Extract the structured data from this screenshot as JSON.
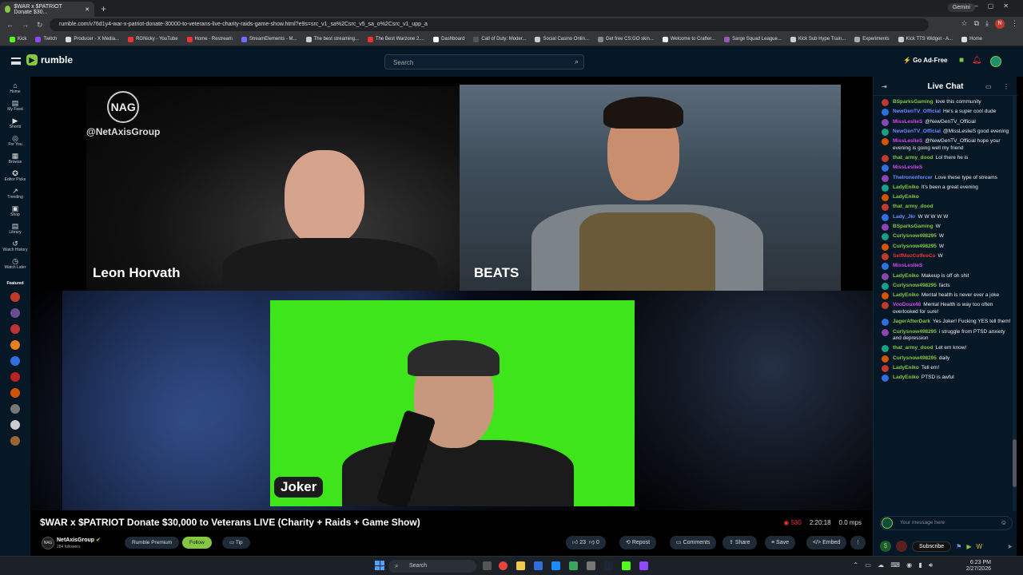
{
  "browser": {
    "tab_title": "$WAR x $PATRIOT Donate $30...",
    "gemini_label": "Gemini",
    "url": "rumble.com/v76d1y4-war-x-patriot-donate-30000-to-veterans-live-charity-raids-game-show.html?e9s=src_v1_sa%2Csrc_v5_sa_o%2Csrc_v1_upp_a",
    "profile_initial": "N",
    "bookmarks": [
      "Kick",
      "Twitch",
      "Producer - X Media...",
      "RGNicky - YouTube",
      "Home - Restream",
      "StreamElements - M...",
      "The best streaming...",
      "The Best Warzone 2....",
      "Dashboard",
      "Call of Duty: Moder...",
      "Social Casino Onlin...",
      "Get free CS:GO skin...",
      "Welcome to Crafter...",
      "Sarge Squad League...",
      "Kick Sub Hype Train...",
      "Experiments",
      "Kick TTS Widget - A...",
      "Home"
    ]
  },
  "header": {
    "logo_text": "rumble",
    "search_placeholder": "Search",
    "go_ad_free": "Go Ad-Free"
  },
  "sidebar": {
    "items": [
      "Home",
      "My Feed",
      "Shorts",
      "For You",
      "Browse",
      "Editor Picks",
      "Trending",
      "Shop",
      "Library",
      "Watch History",
      "Watch Later"
    ],
    "featured_label": "Featured"
  },
  "video": {
    "overlay_logo": "NAG",
    "overlay_handle": "@NetAxisGroup",
    "name1": "Leon Horvath",
    "name2": "BEATS",
    "name3": "Joker",
    "title": "$WAR x $PATRIOT Donate $30,000 to Veterans LIVE (Charity + Raids + Game Show)",
    "viewers": "580",
    "duration": "2:20:18",
    "bitrate": "0.0 mps",
    "channel_name": "NetAxisGroup",
    "followers": "284 followers",
    "premium_label": "Rumble Premium",
    "follow_label": "Follow",
    "tip_label": "Tip",
    "likes": "23",
    "dislikes": "0",
    "actions": [
      "Repost",
      "Comments",
      "Share",
      "Save",
      "Embed"
    ]
  },
  "chat": {
    "title": "Live Chat",
    "input_placeholder": "Your message here",
    "subscribe_label": "Subscribe",
    "messages": [
      {
        "user": "BSparksGaming",
        "color": "#85c742",
        "text": "love this community"
      },
      {
        "user": "NewGenTV_Official",
        "color": "#6f8cff",
        "text": "He's a super cool dude"
      },
      {
        "user": "MissLeslieS",
        "color": "#d946ef",
        "text": "@NewGenTV_Official"
      },
      {
        "user": "NewGenTV_Official",
        "color": "#6f8cff",
        "text": "@MissLeslieS good evening"
      },
      {
        "user": "MissLeslieS",
        "color": "#d946ef",
        "text": "@NewGenTV_Official hope your evening is going well my friend"
      },
      {
        "user": "that_army_dood",
        "color": "#85c742",
        "text": "Lol there he is"
      },
      {
        "user": "MissLeslieS",
        "color": "#d946ef",
        "text": ""
      },
      {
        "user": "TheIronenforcer",
        "color": "#6f8cff",
        "text": "Love these type of streams"
      },
      {
        "user": "LadyEniko",
        "color": "#85c742",
        "text": "It's been a great evening"
      },
      {
        "user": "LadyEniko",
        "color": "#85c742",
        "text": ""
      },
      {
        "user": "that_army_dood",
        "color": "#85c742",
        "text": ""
      },
      {
        "user": "Lady_Jkr",
        "color": "#6f8cff",
        "text": "W W W W W"
      },
      {
        "user": "BSparksGaming",
        "color": "#85c742",
        "text": "W"
      },
      {
        "user": "Curlysnow498295",
        "color": "#85c742",
        "text": "W"
      },
      {
        "user": "Curlysnow498295",
        "color": "#85c742",
        "text": "W"
      },
      {
        "user": "SelfMozCoffeeCo",
        "color": "#e33",
        "text": "W"
      },
      {
        "user": "MissLeslieS",
        "color": "#d946ef",
        "text": ""
      },
      {
        "user": "LadyEniko",
        "color": "#85c742",
        "text": "Makeup is off oh shit"
      },
      {
        "user": "Curlysnow498295",
        "color": "#85c742",
        "text": "facts"
      },
      {
        "user": "LadyEniko",
        "color": "#85c742",
        "text": "Mental health is never ever a joke"
      },
      {
        "user": "VooDoux48",
        "color": "#d946ef",
        "text": "Mental Health is way too often overlooked for sure!"
      },
      {
        "user": "JagerAfterDark",
        "color": "#85c742",
        "text": "Yes Joker! Fucking YES tell them!"
      },
      {
        "user": "Curlysnow498295",
        "color": "#85c742",
        "text": "i struggle from PTSD anxiety and depression"
      },
      {
        "user": "that_army_dood",
        "color": "#85c742",
        "text": "Let em know!"
      },
      {
        "user": "Curlysnow498295",
        "color": "#85c742",
        "text": "daily"
      },
      {
        "user": "LadyEniko",
        "color": "#85c742",
        "text": "Tell em!"
      },
      {
        "user": "LadyEniko",
        "color": "#85c742",
        "text": "PTSD is awful"
      }
    ]
  },
  "taskbar": {
    "search_label": "Search",
    "time": "6:23 PM",
    "date": "2/27/2026"
  }
}
